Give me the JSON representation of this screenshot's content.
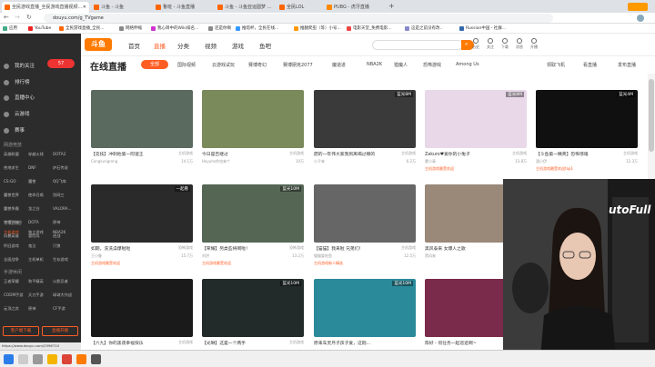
{
  "browser": {
    "tabs": [
      {
        "title": "全民游戏直播_全民游戏直播视频..."
      },
      {
        "title": "斗鱼 - 斗鱼"
      },
      {
        "title": "鲁班 - 斗鱼直播"
      },
      {
        "title": "斗鱼 - 斗鱼亚运圆梦 ..."
      },
      {
        "title": "全民LOL"
      },
      {
        "title": "PUBG - 虎牙直播"
      }
    ],
    "url": "douyu.com/g_TVgame",
    "bookmarks": [
      "应用",
      "YouTube",
      "全民游戏直播_全民...",
      "网络伸缩",
      "我心目中的Wiki排名...",
      "还是你啊",
      "推塔杯，全民在线...",
      "推翻爬虫（等）小号...",
      "电影天堂_免费电影...",
      "这是之前没有改..",
      "Russian中国 - 社群..."
    ]
  },
  "sidebar": {
    "user_label": "我的关注",
    "user_count": "57",
    "items": [
      "排行榜",
      "直播中心",
      "云游戏",
      "赛事"
    ],
    "hot_head": "网游竞技",
    "hot_games": [
      "英雄联盟",
      "穿越火线",
      "DOTA2",
      "绝地求生",
      "DNF",
      "炉石传说",
      "CS:GO",
      "魔兽",
      "QQ飞车",
      "魔兽世界",
      "使命召唤",
      "剑网三",
      "魔兽争霸",
      "龙之谷",
      "VALORA...",
      "守望先锋",
      "DOTA",
      "原神",
      "风暴英雄",
      "冒险岛",
      "逆战",
      "QQ飞车"
    ],
    "single_head": "单机热游",
    "single_games": [
      "主机游戏",
      "独立游戏",
      "NBA2K",
      "怀旧游戏",
      "鬼泣",
      "只狼",
      "全面战争",
      "主机单机",
      "生存游戏"
    ],
    "mobile_head": "手游休闲",
    "mobile_games": [
      "王者荣耀",
      "和平精英",
      "火影忍者",
      "CODM手游",
      "天刀手游",
      "球球大作战",
      "云顶之弈",
      "原神",
      "CF手游"
    ],
    "btn_left": "客户端下载",
    "btn_right": "直播开播"
  },
  "topnav": {
    "logo": "斗鱼",
    "items": [
      "首页",
      "直播",
      "分类",
      "视频",
      "游戏",
      "鱼吧"
    ],
    "active_index": 1,
    "tools": [
      "历史",
      "关注",
      "下载",
      "消息",
      "开播"
    ]
  },
  "subbar": {
    "title": "在线直播",
    "active_pill": "全部",
    "categories": [
      "国际视频",
      "云游戏试玩",
      "赛博奇幻",
      "赛博朋克2077",
      "魔道进",
      "NBA2K",
      "猎魔人",
      "恐怖游戏",
      "Among Us"
    ],
    "right_items": [
      "领取飞机",
      "看直播",
      "发布直播"
    ]
  },
  "cards": [
    {
      "title": "【竞技】冲刺他第一阿速王",
      "cat": "主机游戏",
      "streamer": "Conglunigreng",
      "hot": "14.1万",
      "badge": "",
      "tag": "",
      "thumb": "#5a6a5e"
    },
    {
      "title": "今日是否继过",
      "cat": "主机游戏",
      "streamer": "Hayuhs你也来个",
      "hot": "10万",
      "badge": "",
      "tag": "",
      "thumb": "#7a8a5a"
    },
    {
      "title": "蔚的一年伟大家我到离喝过哪的",
      "cat": "主机游戏",
      "streamer": "小子来",
      "hot": "6.2万",
      "badge": "蓝光8M",
      "tag": "",
      "thumb": "#3a3a3a"
    },
    {
      "title": "Zakuro♥爱你的小兔子",
      "cat": "主机游戏",
      "streamer": "蒙小青",
      "hot": "13.8万",
      "badge": "蓝光8M",
      "tag": "主机游戏最受欢迎",
      "thumb": "#e8d8e8"
    },
    {
      "title": "【斗鱼第一精英】恐怖惊魂",
      "cat": "主机游戏",
      "streamer": "酒小伊",
      "hot": "12.3万",
      "badge": "蓝光4M",
      "tag": "主机游戏最受欢迎top1",
      "thumb": "#101010"
    },
    {
      "title": "如期，洗洗澡爆啦啦",
      "cat": "恐怖游戏",
      "streamer": "王小鲁",
      "hot": "15.7万",
      "badge": "一起看",
      "tag": "主机游戏最受欢迎",
      "thumb": "#2a2a2a"
    },
    {
      "title": "【荣耀】另类些将啊啦！",
      "cat": "恐怖游戏",
      "streamer": "刘洪",
      "hot": "13.2万",
      "badge": "蓝光10M",
      "tag": "主机游戏最受欢迎",
      "thumb": "#556655"
    },
    {
      "title": "【猫猫】我来啦 兄弟们！",
      "cat": "主机游戏",
      "streamer": "猫猫爱吃鱼",
      "hot": "12.5万",
      "badge": "",
      "tag": "主机游戏新人精选",
      "thumb": "#666666"
    },
    {
      "title": "黑风泰来 女爆人之歌",
      "cat": "主机游戏",
      "streamer": "黑风来",
      "hot": "10.6万",
      "badge": "蓝光4M",
      "tag": "",
      "thumb": "#9a8878"
    },
    {
      "title": "",
      "cat": "",
      "streamer": "",
      "hot": "",
      "badge": "蓝光10M",
      "tag": "",
      "thumb": "#3a3030"
    },
    {
      "title": "【六九】你的黑夜幸福快乐",
      "cat": "主机游戏",
      "streamer": "",
      "hot": "",
      "badge": "",
      "tag": "",
      "thumb": "#1a1a1a"
    },
    {
      "title": "【光琳】这是一个两手",
      "cat": "主机游戏",
      "streamer": "",
      "hot": "",
      "badge": "蓝光10M",
      "tag": "",
      "thumb": "#222a2a"
    },
    {
      "title": "原来车灵月子孩子爱，这刚...",
      "cat": "",
      "streamer": "",
      "hot": "",
      "badge": "蓝光10M",
      "tag": "",
      "thumb": "#2a8a9a"
    },
    {
      "title": "陈好 - 何任务一起巡迹啊~",
      "cat": "",
      "streamer": "",
      "hot": "",
      "badge": "",
      "tag": "",
      "thumb": "#7a2a4a"
    }
  ],
  "status_url": "https://www.douyu.com/2596710"
}
